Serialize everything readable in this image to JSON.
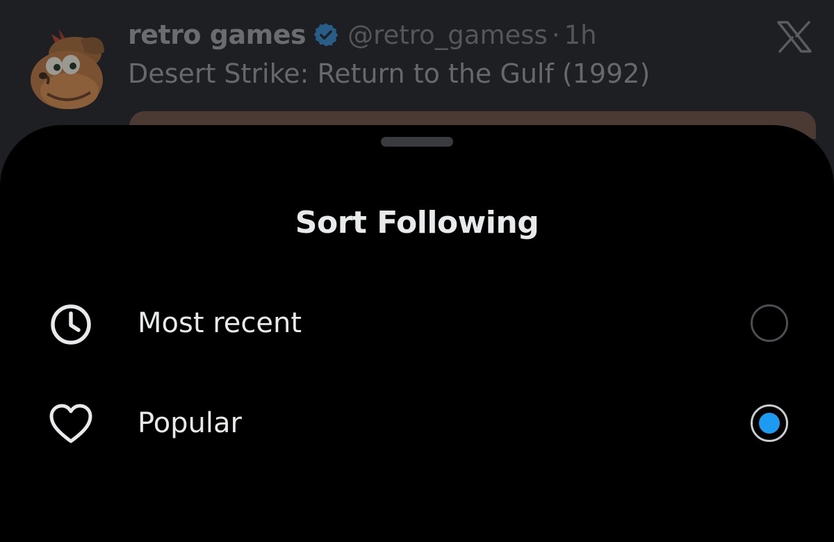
{
  "tweet": {
    "author_name": "retro games",
    "handle": "@retro_gamess",
    "separator": "·",
    "time": "1h",
    "text": "Desert Strike: Return to the Gulf (1992)"
  },
  "icons": {
    "verified": "verified-badge-icon",
    "app_logo": "x-logo-icon",
    "most_recent": "clock-icon",
    "popular": "heart-icon"
  },
  "colors": {
    "accent": "#1d9bf0",
    "sheet_background": "#000000",
    "text_primary": "#e7e9ea"
  },
  "sheet": {
    "title": "Sort Following",
    "options": [
      {
        "label": "Most recent",
        "selected": false
      },
      {
        "label": "Popular",
        "selected": true
      }
    ]
  }
}
